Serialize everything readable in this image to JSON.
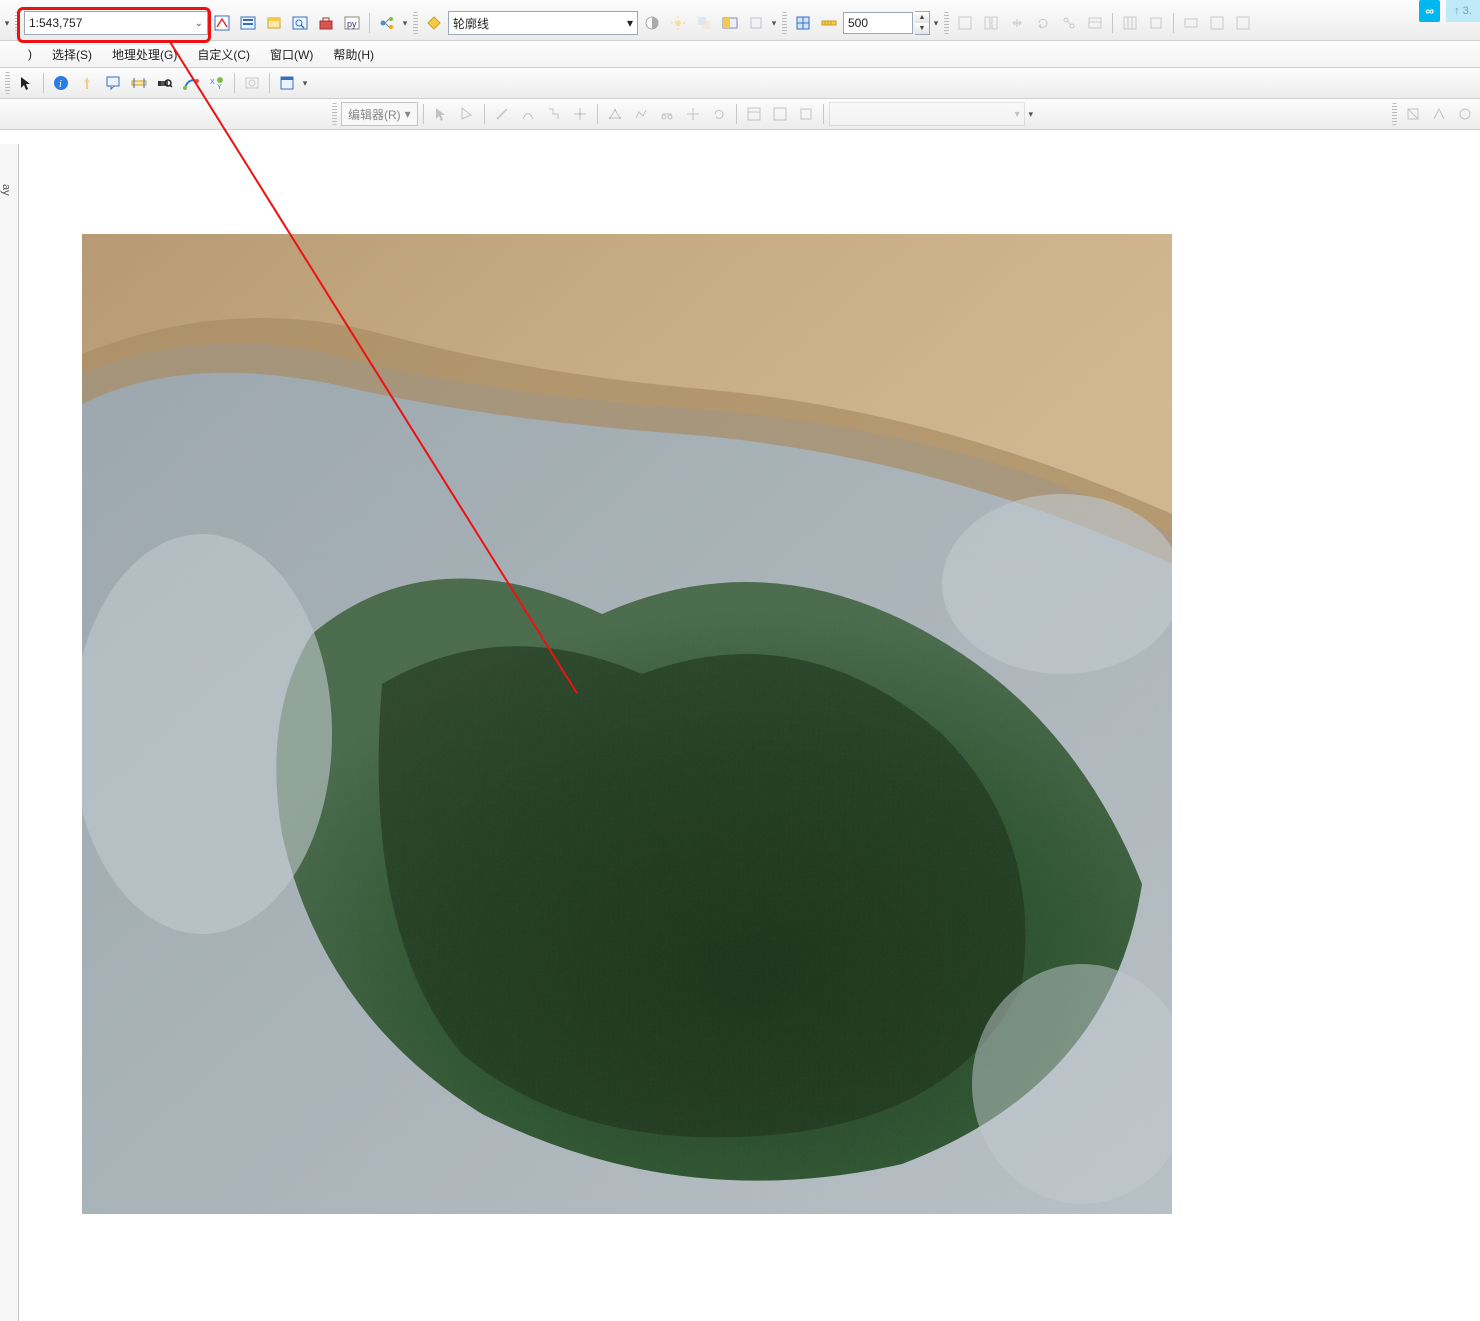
{
  "top_badge": {
    "text": "∞",
    "suffix": "↑ 3."
  },
  "scale": {
    "value": "1:543,757"
  },
  "layer_combo": {
    "icon": "diamond",
    "value": "轮廓线"
  },
  "buffer": {
    "value": "500"
  },
  "menus": {
    "partial_left": ")",
    "select": "选择(S)",
    "geoprocessing": "地理处理(G)",
    "customize": "自定义(C)",
    "window": "窗口(W)",
    "help": "帮助(H)"
  },
  "editor": {
    "label": "编辑器(R)",
    "caret": "▾"
  },
  "left_tab": "ay",
  "toolbar_icons": {
    "row1": [
      "editor-toolbar-icon",
      "toc-icon",
      "catalog-icon",
      "search-window-icon",
      "toolbox-icon",
      "python-icon",
      "model-builder-icon"
    ],
    "effects": [
      "contrast-icon",
      "brightness-icon",
      "transparency-icon",
      "swipe-icon",
      "flicker-icon"
    ],
    "measure": [
      "grid-icon",
      "ruler-icon"
    ],
    "georef": [
      "georef-1",
      "georef-2",
      "georef-pan",
      "georef-rotate",
      "georef-link",
      "georef-table",
      "georef-grid",
      "georef-5",
      "georef-6",
      "georef-7",
      "georef-8"
    ],
    "row3": [
      "pointer-icon",
      "identify-icon",
      "flash-icon",
      "html-popup-icon",
      "measure-icon",
      "find-icon",
      "find-route-icon",
      "xy-icon",
      "time-slider-icon",
      "viewer-icon"
    ],
    "editor_tools": [
      "edit-pointer",
      "edit-arrow",
      "edit-line",
      "edit-arc",
      "edit-trace",
      "edit-point",
      "edit-vertex",
      "edit-reshape",
      "edit-cut",
      "edit-split",
      "edit-rotate",
      "edit-attributes",
      "edit-sketch",
      "edit-a",
      "edit-b"
    ],
    "right_tools": [
      "snap-1",
      "snap-2",
      "snap-3"
    ]
  }
}
